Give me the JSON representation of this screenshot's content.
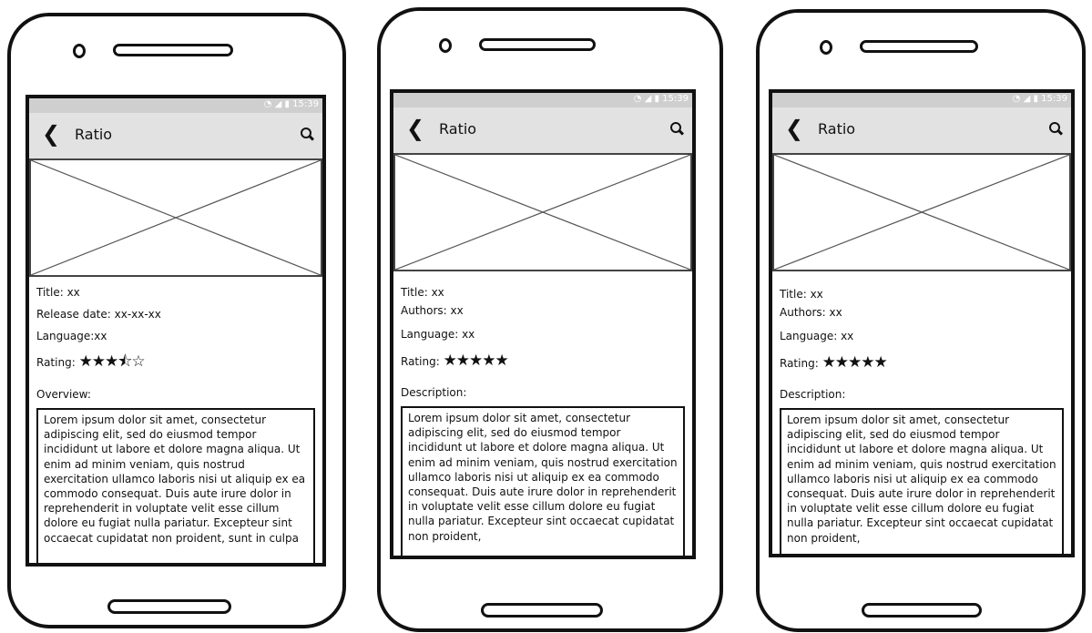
{
  "status_time": "15:39",
  "phones": [
    {
      "app_title": "Ratio",
      "fields": [
        {
          "label": "Title: xx"
        },
        {
          "label": "Release date: xx-xx-xx"
        },
        {
          "label": "Language:xx"
        }
      ],
      "rating_label": "Rating:",
      "rating_stars": "★★★⯪☆",
      "section_label": "Overview:",
      "text": "Lorem ipsum dolor sit amet, consectetur adipiscing elit, sed do eiusmod tempor incididunt ut labore et dolore magna aliqua. Ut enim ad minim veniam, quis nostrud exercitation ullamco laboris nisi ut aliquip ex ea commodo consequat. Duis aute irure dolor in reprehenderit in voluptate velit esse cillum dolore eu fugiat nulla pariatur. Excepteur sint occaecat cupidatat non proident, sunt in culpa"
    },
    {
      "app_title": "Ratio",
      "fields": [
        {
          "label": "Title: xx"
        },
        {
          "label": "Authors: xx"
        },
        {
          "label": "Language: xx"
        }
      ],
      "rating_label": "Rating:",
      "rating_stars": "★★★★★",
      "section_label": "Description:",
      "text": "Lorem ipsum dolor sit amet, consectetur adipiscing elit, sed do eiusmod tempor incididunt ut labore et dolore magna aliqua. Ut enim ad minim veniam, quis nostrud exercitation ullamco laboris nisi ut aliquip ex ea commodo consequat. Duis aute irure dolor in reprehenderit in voluptate velit esse cillum dolore eu fugiat nulla pariatur. Excepteur sint occaecat cupidatat non proident,"
    },
    {
      "app_title": "Ratio",
      "fields": [
        {
          "label": "Title: xx"
        },
        {
          "label": "Authors: xx"
        },
        {
          "label": "Language: xx"
        }
      ],
      "rating_label": "Rating:",
      "rating_stars": "★★★★★",
      "section_label": "Description:",
      "text": "Lorem ipsum dolor sit amet, consectetur adipiscing elit, sed do eiusmod tempor incididunt ut labore et dolore magna aliqua. Ut enim ad minim veniam, quis nostrud exercitation ullamco laboris nisi ut aliquip ex ea commodo consequat. Duis aute irure dolor in reprehenderit in voluptate velit esse cillum dolore eu fugiat nulla pariatur. Excepteur sint occaecat cupidatat non proident,"
    }
  ]
}
